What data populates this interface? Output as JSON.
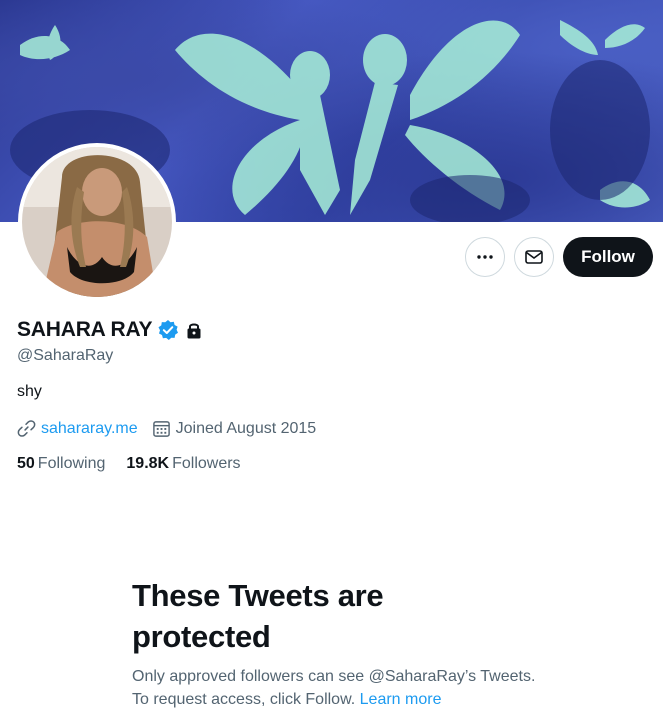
{
  "profile": {
    "display_name": "SAHARA RAY",
    "handle": "@SaharaRay",
    "bio": "shy",
    "website": "sahararay.me",
    "joined": "Joined August 2015",
    "following_count": "50",
    "following_label": "Following",
    "followers_count": "19.8K",
    "followers_label": "Followers",
    "verified_badge": "verified-badge-icon",
    "protected_badge": "lock-icon"
  },
  "actions": {
    "more_icon": "more-icon",
    "message_icon": "envelope-icon",
    "follow_label": "Follow"
  },
  "protected_notice": {
    "title": "These Tweets are protected",
    "description": "Only approved followers can see @SaharaRay’s Tweets. To request access, click Follow.",
    "learn_more": "Learn more"
  },
  "colors": {
    "accent": "#1d9bf0",
    "text_primary": "#0f1419",
    "text_secondary": "#536471",
    "follow_button_bg": "#0f1419",
    "border": "#cfd9de"
  }
}
